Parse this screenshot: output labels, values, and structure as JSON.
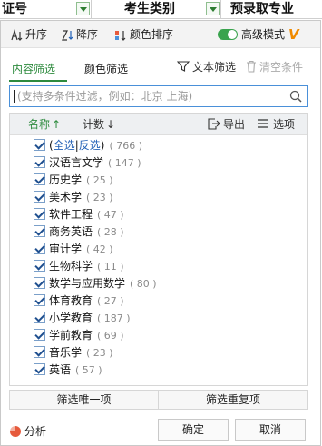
{
  "sheet_header": {
    "col1": "证号",
    "col2": "考生类别",
    "col3": "预录取专业"
  },
  "sort_bar": {
    "asc": "升序",
    "desc": "降序",
    "color_sort": "颜色排序",
    "advanced_mode": "高级模式",
    "advanced_enabled": true,
    "accent": "#39a34d"
  },
  "tabs": {
    "content_filter": "内容筛选",
    "color_filter": "颜色筛选",
    "text_filter": "文本筛选",
    "clear_conditions": "清空条件"
  },
  "search": {
    "placeholder": "(支持多条件过滤，例如：北京  上海)"
  },
  "list_header": {
    "name": "名称",
    "name_sort": "↑",
    "count": "计数",
    "count_sort": "↓",
    "export": "导出",
    "options": "选项"
  },
  "items": [
    {
      "select_all": "全选",
      "invert": "反选",
      "count": "( 766 )",
      "checked": true
    },
    {
      "label": "汉语言文学",
      "count": "( 147 )",
      "checked": true
    },
    {
      "label": "历史学",
      "count": "( 25 )",
      "checked": true
    },
    {
      "label": "美术学",
      "count": "( 23 )",
      "checked": true
    },
    {
      "label": "软件工程",
      "count": "( 47 )",
      "checked": true
    },
    {
      "label": "商务英语",
      "count": "( 28 )",
      "checked": true
    },
    {
      "label": "审计学",
      "count": "( 42 )",
      "checked": true
    },
    {
      "label": "生物科学",
      "count": "( 11 )",
      "checked": true
    },
    {
      "label": "数学与应用数学",
      "count": "( 80 )",
      "checked": true
    },
    {
      "label": "体育教育",
      "count": "( 27 )",
      "checked": true
    },
    {
      "label": "小学教育",
      "count": "( 187 )",
      "checked": true
    },
    {
      "label": "学前教育",
      "count": "( 69 )",
      "checked": true
    },
    {
      "label": "音乐学",
      "count": "( 23 )",
      "checked": true
    },
    {
      "label": "英语",
      "count": "( 57 )",
      "checked": true
    }
  ],
  "bottom_buttons": {
    "unique": "筛选唯一项",
    "duplicate": "筛选重复项"
  },
  "footer": {
    "analyze": "分析",
    "ok": "确定",
    "cancel": "取消"
  }
}
